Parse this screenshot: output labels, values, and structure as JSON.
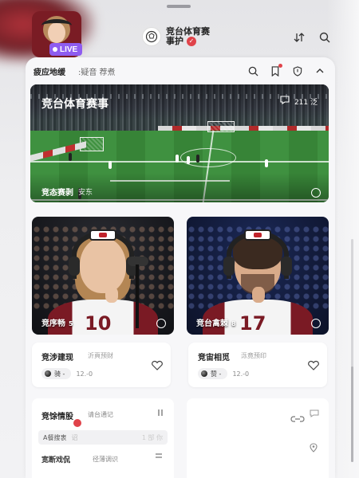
{
  "live": {
    "badge": "LIVE"
  },
  "header": {
    "title": "竞台体育赛",
    "subtitle": "事护"
  },
  "toolbar": {
    "title": "疲应地缓",
    "sub": ":疑音 荐煮"
  },
  "hero": {
    "title": "竞台体育赛事",
    "meta": "211 泛",
    "caption": "竞态赛剥",
    "caption_sub": "安东"
  },
  "hosts": [
    {
      "label": "竞序畅",
      "sub": "5",
      "jersey_number": "10"
    },
    {
      "label": "竞台禽棘",
      "sub": "8",
      "jersey_number": "17"
    }
  ],
  "info_cards": [
    {
      "title": "竞涉建现",
      "tag": "沂頁预财",
      "pill": "骑 -",
      "value": "12.-0"
    },
    {
      "title": "竞宙相觅",
      "tag": "泺竟预印",
      "pill": "赞 -",
      "value": "12.-0"
    }
  ],
  "bottom_a": {
    "title": "竞馀情股",
    "tag": "请台通记",
    "field_value": "A餐搜衷",
    "field_ghost": "诏",
    "field_ghost2": "1 郜 你",
    "row2": "宽断戏侃",
    "row2_tag": "径薄调识"
  },
  "colors": {
    "live_badge": "#8e5cf0",
    "accent_red": "#e0434a",
    "pitch_green": "#3c8a3a",
    "jersey_maroon": "#7a1a24"
  },
  "icons": {
    "brand": "football-logo-icon",
    "sort": "sort-icon",
    "search": "search-icon",
    "bookmark": "bookmark-icon",
    "shield": "shield-icon",
    "collapse": "chevron-up-icon",
    "heart": "heart-icon",
    "comment": "comment-icon",
    "pin": "location-pin-icon"
  }
}
